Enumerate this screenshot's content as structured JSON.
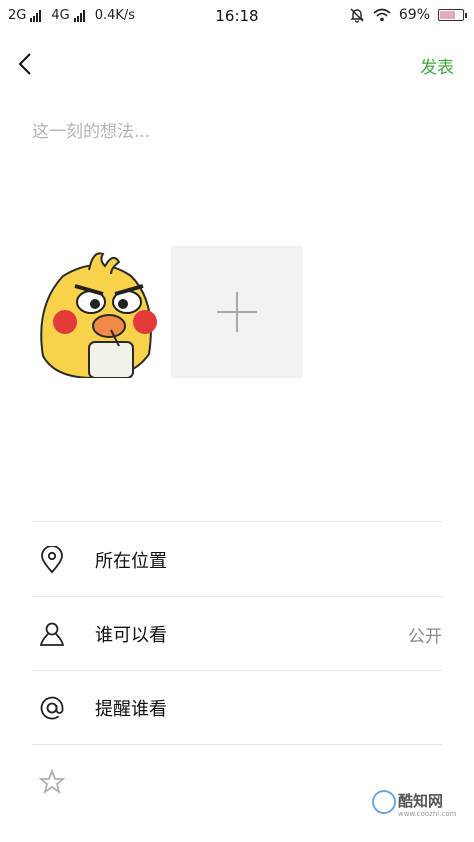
{
  "status_bar": {
    "left_text": "2G",
    "network2": "4G",
    "speed": "0.4K/s",
    "time": "16:18",
    "battery": "69%",
    "battery_level": 0.69,
    "battery_color": "#e9a9b6"
  },
  "header": {
    "back_icon": "chevron-left-icon",
    "publish_label": "发表",
    "publish_color": "#3fa83f"
  },
  "compose": {
    "placeholder": "这一刻的想法...",
    "value": ""
  },
  "media": {
    "items": [
      {
        "kind": "sticker",
        "description_icon": "duck-sticker-image"
      }
    ],
    "add_icon": "plus-icon"
  },
  "options": [
    {
      "icon": "location-pin-icon",
      "label": "所在位置",
      "value": ""
    },
    {
      "icon": "person-icon",
      "label": "谁可以看",
      "value": "公开"
    },
    {
      "icon": "at-sign-icon",
      "label": "提醒谁看",
      "value": ""
    },
    {
      "icon": "star-icon",
      "label": "",
      "value": ""
    }
  ],
  "watermark": {
    "text": "酷知网",
    "subtext": "www.coozhi.com"
  }
}
